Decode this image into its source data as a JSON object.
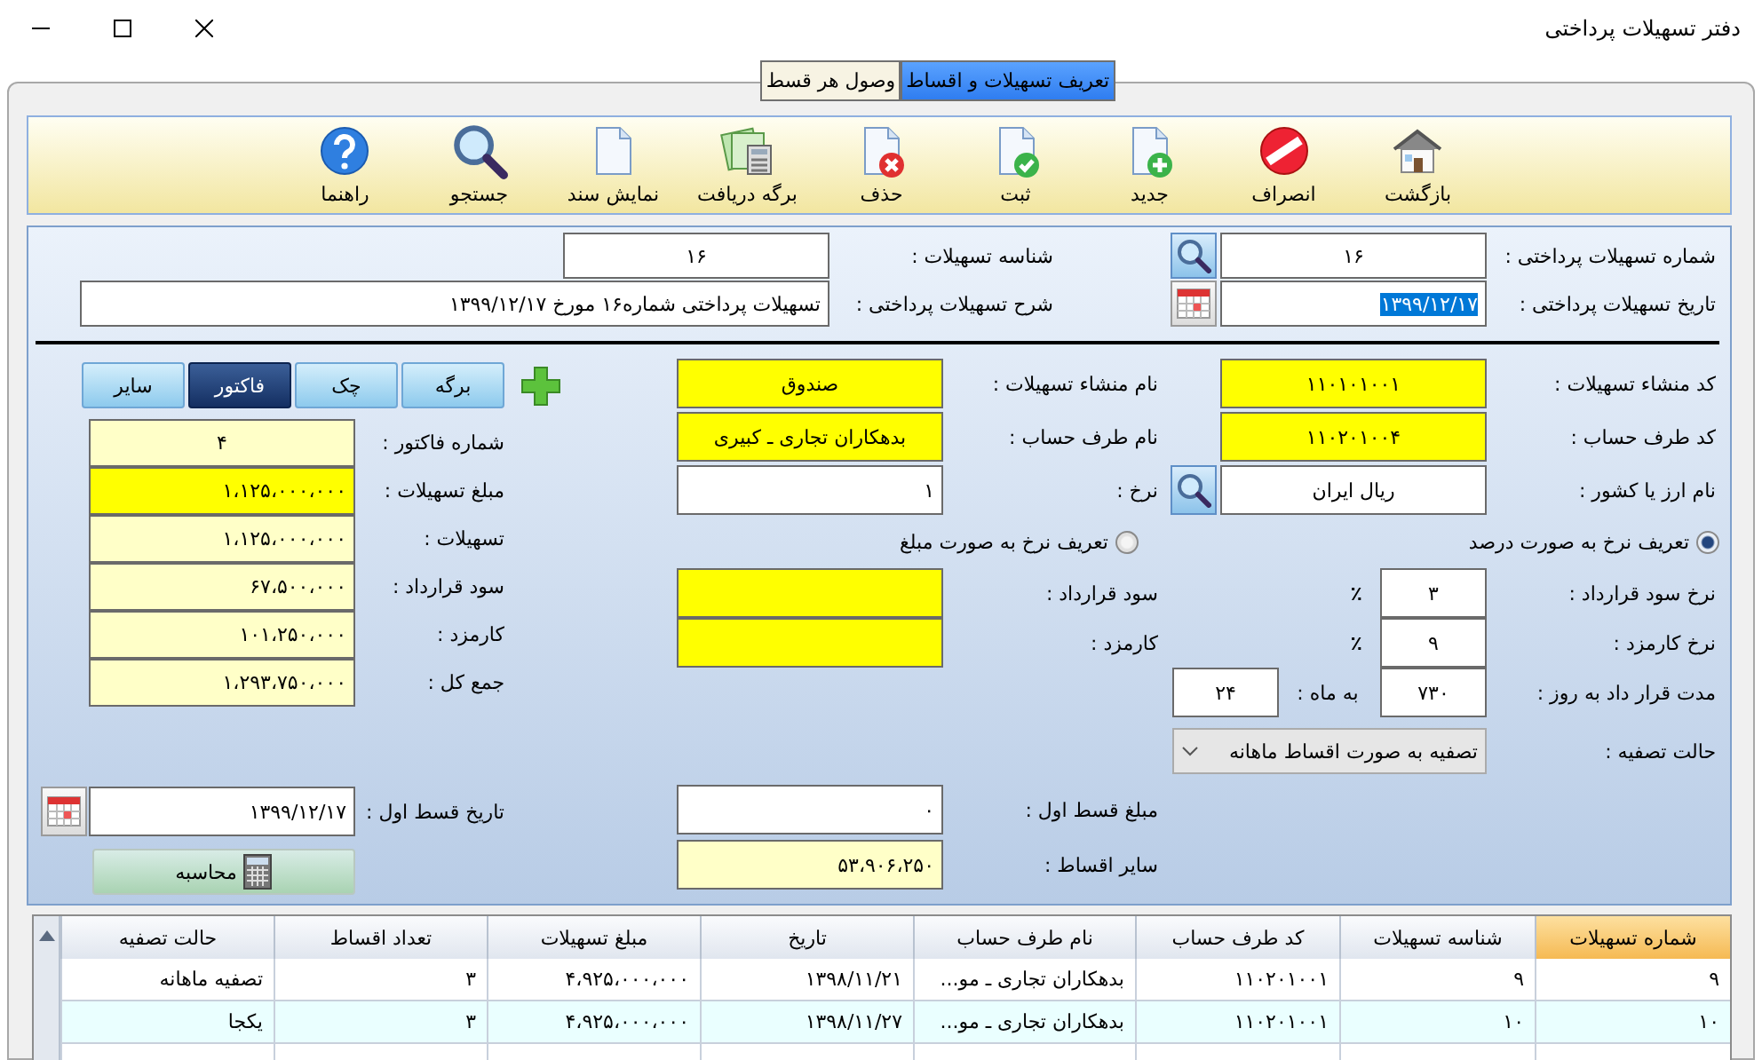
{
  "window": {
    "title": "دفتر تسهیلات پرداختی"
  },
  "tabs": [
    {
      "label": "تعریف تسهیلات و اقساط",
      "selected": true
    },
    {
      "label": "وصول هر قسط",
      "selected": false
    }
  ],
  "toolbar": [
    {
      "kind": "home",
      "label": "بازگشت"
    },
    {
      "kind": "cancel",
      "label": "انصراف"
    },
    {
      "kind": "new",
      "label": "جدید"
    },
    {
      "kind": "save",
      "label": "ثبت"
    },
    {
      "kind": "delete",
      "label": "حذف"
    },
    {
      "kind": "receipt",
      "label": "برگه دریافت"
    },
    {
      "kind": "document",
      "label": "نمایش سند"
    },
    {
      "kind": "search",
      "label": "جستجو"
    },
    {
      "kind": "help",
      "label": "راهنما"
    }
  ],
  "header": {
    "number": {
      "label": "شماره تسهیلات پرداختی :",
      "value": "۱۶"
    },
    "id": {
      "label": "شناسه تسهیلات :",
      "value": "۱۶"
    },
    "date": {
      "label": "تاریخ  تسهیلات پرداختی :",
      "value": "۱۳۹۹/۱۲/۱۷",
      "text_selected": true
    },
    "description": {
      "label": "شرح  تسهیلات پرداختی :",
      "value": "تسهیلات پرداختی شماره۱۶ مورخ ۱۳۹۹/۱۲/۱۷"
    }
  },
  "right_fields": [
    {
      "label": "کد منشاء تسهیلات :",
      "value": "۱۱۰۱۰۱۰۰۱",
      "kind": "required"
    },
    {
      "label": "کد طرف حساب :",
      "value": "۱۱۰۲۰۱۰۰۴",
      "kind": "required"
    },
    {
      "label": "نام ارز یا کشور :",
      "value": "ریال ایران",
      "kind": "input"
    }
  ],
  "rate_modes": [
    {
      "label": "تعریف نرخ به صورت درصد",
      "selected": true
    },
    {
      "label": "تعریف نرخ به صورت مبلغ",
      "selected": false
    }
  ],
  "rates": [
    {
      "label": "نرخ سود قرارداد :",
      "value": "۳",
      "unit": "٪"
    },
    {
      "label": "نرخ کارمزد :",
      "value": "۹",
      "unit": "٪"
    }
  ],
  "duration": {
    "label": "مدت قرار داد به روز :",
    "value": "۷۳۰",
    "months_label": "به ماه :",
    "months": "۲۴"
  },
  "settlement": {
    "label": "حالت تصفیه :",
    "value": "تصفیه به صورت اقساط ماهانه"
  },
  "middle_fields": [
    {
      "label": "نام منشاء تسهیلات :",
      "value": "صندوق",
      "kind": "required"
    },
    {
      "label": "نام طرف حساب :",
      "value": "بدهکاران تجاری ـ کبیری",
      "kind": "required"
    },
    {
      "label": "نرخ :",
      "value": "۱",
      "kind": "input"
    }
  ],
  "middle_amounts": [
    {
      "label": "سود قرارداد :",
      "kind": "required"
    },
    {
      "label": "کارمزد :",
      "kind": "required"
    }
  ],
  "installments": [
    {
      "label": "مبلغ قسط اول :",
      "value": "۰",
      "kind": "input"
    },
    {
      "label": "سایر اقساط :",
      "value": "۵۳،۹۰۶،۲۵۰",
      "kind": "computed"
    }
  ],
  "doc_types": [
    {
      "label": "برگه",
      "selected": false
    },
    {
      "label": "چک",
      "selected": false
    },
    {
      "label": "فاکتور",
      "selected": true
    },
    {
      "label": "سایر",
      "selected": false
    }
  ],
  "invoice_fields": [
    {
      "label": "شماره فاکتور :",
      "value": "۴",
      "kind": "computed"
    },
    {
      "label": "مبلغ تسهیلات :",
      "value": "۱،۱۲۵،۰۰۰،۰۰۰",
      "kind": "required"
    },
    {
      "label": "تسهیلات :",
      "value": "۱،۱۲۵،۰۰۰،۰۰۰",
      "kind": "computed"
    },
    {
      "label": "سود قرارداد :",
      "value": "۶۷،۵۰۰،۰۰۰",
      "kind": "computed"
    },
    {
      "label": "کارمزد :",
      "value": "۱۰۱،۲۵۰،۰۰۰",
      "kind": "computed"
    },
    {
      "label": "جمع کل :",
      "value": "۱،۲۹۳،۷۵۰،۰۰۰",
      "kind": "computed"
    }
  ],
  "first_installment_date": {
    "label": "تاریخ قسط اول :",
    "value": "۱۳۹۹/۱۲/۱۷"
  },
  "calculate_button": "محاسبه",
  "table": {
    "columns": [
      {
        "label": "شماره تسهیلات",
        "selected": true
      },
      {
        "label": "شناسه تسهیلات",
        "selected": false
      },
      {
        "label": "کد طرف حساب",
        "selected": false
      },
      {
        "label": "نام طرف حساب",
        "selected": false
      },
      {
        "label": "تاریخ",
        "selected": false
      },
      {
        "label": "مبلغ تسهیلات",
        "selected": false
      },
      {
        "label": "تعداد اقساط",
        "selected": false
      },
      {
        "label": "حالت تصفیه",
        "selected": false
      }
    ],
    "rows": [
      [
        "۹",
        "۹",
        "۱۱۰۲۰۱۰۰۱",
        "بدهکاران تجاری ـ مو...",
        "۱۳۹۸/۱۱/۲۱",
        "۴،۹۲۵،۰۰۰،۰۰۰",
        "۳",
        "تصفیه ماهانه"
      ],
      [
        "۱۰",
        "۱۰",
        "۱۱۰۲۰۱۰۰۱",
        "بدهکاران تجاری ـ مو...",
        "۱۳۹۸/۱۱/۲۷",
        "۴،۹۲۵،۰۰۰،۰۰۰",
        "۳",
        "یکجا"
      ]
    ]
  }
}
